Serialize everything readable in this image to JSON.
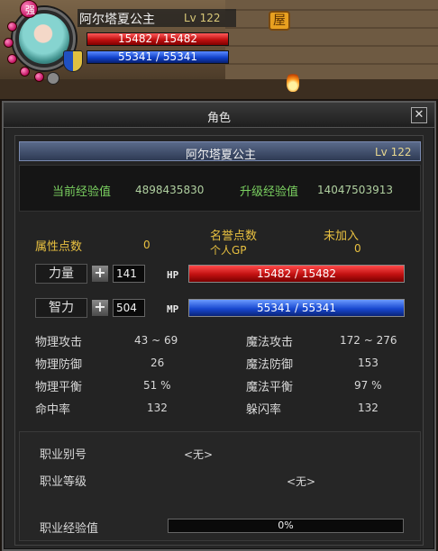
{
  "hud": {
    "gem_label": "强",
    "sign_glyph": "屋",
    "name": "阿尔塔夏公主",
    "level": "Lv 122",
    "hp": "15482 / 15482",
    "mp": "55341 / 55341"
  },
  "window": {
    "title": "角色",
    "close_glyph": "✕"
  },
  "character": {
    "name": "阿尔塔夏公主",
    "level": "Lv 122"
  },
  "experience": {
    "current_label": "当前经验值",
    "current_value": "4898435830",
    "next_label": "升级经验值",
    "next_value": "14047503913"
  },
  "points": {
    "attr_label": "属性点数",
    "attr_value": "0",
    "honor_label": "名誉点数",
    "not_added_label": "未加入",
    "gp_label": "个人GP",
    "gp_value": "0"
  },
  "stats": {
    "strength_label": "力量",
    "strength_value": "141",
    "hp_tag": "HP",
    "hp_value": "15482 / 15482",
    "intellect_label": "智力",
    "intellect_value": "504",
    "mp_tag": "MP",
    "mp_value": "55341 / 55341",
    "plus_glyph": "+"
  },
  "combat": {
    "left": [
      {
        "label": "物理攻击",
        "value": "43 ~ 69"
      },
      {
        "label": "物理防御",
        "value": "26"
      },
      {
        "label": "物理平衡",
        "value": "51 %"
      },
      {
        "label": "命中率",
        "value": "132"
      }
    ],
    "right": [
      {
        "label": "魔法攻击",
        "value": "172 ~ 276"
      },
      {
        "label": "魔法防御",
        "value": "153"
      },
      {
        "label": "魔法平衡",
        "value": "97 %"
      },
      {
        "label": "躲闪率",
        "value": "132"
      }
    ]
  },
  "job": {
    "title_label": "职业别号",
    "title_value": "<无>",
    "level_label": "职业等级",
    "level_value": "<无>",
    "exp_label": "职业经验值",
    "exp_value": "0%",
    "exp_fraction": 0
  }
}
